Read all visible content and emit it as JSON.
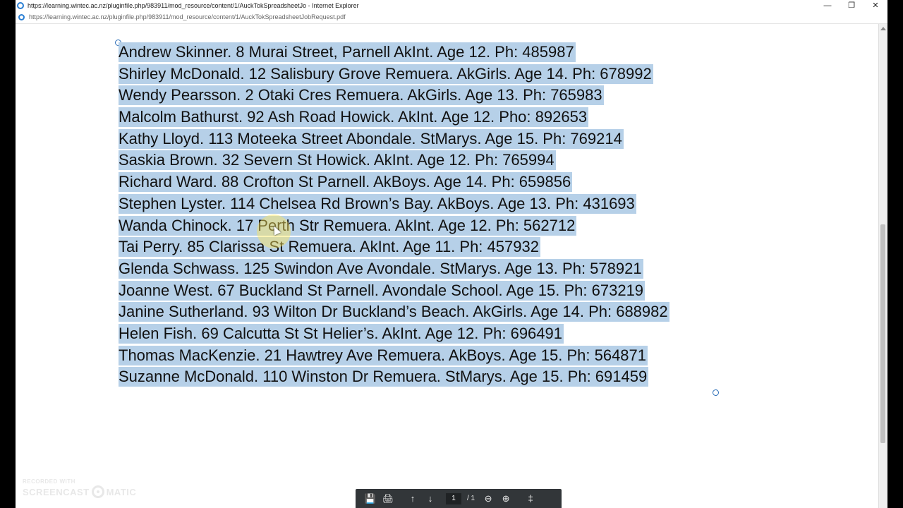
{
  "window": {
    "title": "https://learning.wintec.ac.nz/pluginfile.php/983911/mod_resource/content/1/AuckTokSpreadsheetJo - Internet Explorer",
    "address": "https://learning.wintec.ac.nz/pluginfile.php/983911/mod_resource/content/1/AuckTokSpreadsheetJobRequest.pdf",
    "controls": {
      "minimize": "—",
      "restore": "❐",
      "close": "✕"
    }
  },
  "document": {
    "lines": [
      "Andrew Skinner. 8 Murai Street, Parnell AkInt. Age 12. Ph: 485987",
      "Shirley McDonald. 12 Salisbury Grove Remuera. AkGirls. Age 14. Ph: 678992",
      "Wendy Pearsson. 2 Otaki Cres Remuera. AkGirls. Age 13. Ph: 765983",
      "Malcolm Bathurst. 92 Ash Road Howick. AkInt. Age 12. Pho: 892653",
      "Kathy Lloyd. 113 Moteeka Street Abondale. StMarys. Age 15. Ph: 769214",
      "Saskia Brown. 32 Severn St Howick. AkInt. Age 12. Ph: 765994",
      "Richard Ward. 88 Crofton St Parnell. AkBoys. Age 14. Ph: 659856",
      "Stephen Lyster. 114 Chelsea Rd Brown’s Bay. AkBoys. Age 13. Ph: 431693",
      "Wanda Chinock. 17 Perth Str Remuera. AkInt. Age 12. Ph: 562712",
      "Tai Perry. 85 Clarissa St Remuera. AkInt. Age 11. Ph: 457932",
      "Glenda Schwass. 125 Swindon Ave Avondale. StMarys. Age 13. Ph: 578921",
      "Joanne West. 67 Buckland St Parnell. Avondale School. Age 15. Ph: 673219",
      "Janine Sutherland. 93 Wilton Dr Buckland’s Beach. AkGirls. Age 14. Ph: 688982",
      "Helen Fish. 69 Calcutta St St Helier’s. AkInt. Age 12. Ph: 696491",
      "Thomas MacKenzie. 21 Hawtrey Ave Remuera. AkBoys. Age 15. Ph: 564871",
      "Suzanne McDonald. 110 Winston Dr Remuera. StMarys. Age 15. Ph: 691459"
    ],
    "selection_color": "#b6d0e8"
  },
  "toolbar": {
    "save_icon": "💾",
    "print_icon": "🖨",
    "prev_page_icon": "↑",
    "next_page_icon": "↓",
    "page_current": "1",
    "page_total": "/ 1",
    "zoom_out_icon": "⊖",
    "zoom_in_icon": "⊕",
    "acrobat_icon": "‡"
  },
  "watermark": {
    "recorded": "RECORDED WITH",
    "brand_left": "SCREENCAST",
    "brand_right": "MATIC"
  }
}
